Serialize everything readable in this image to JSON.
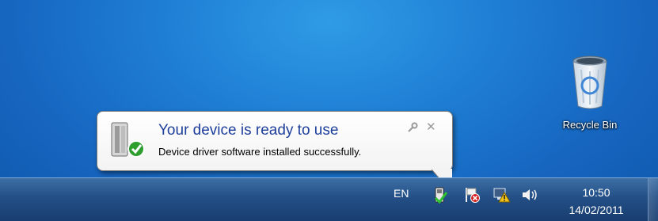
{
  "desktop": {
    "recycle_bin": {
      "label": "Recycle Bin",
      "icon": "recycle-bin-icon"
    }
  },
  "notification": {
    "title": "Your device is ready to use",
    "message": "Device driver software installed successfully.",
    "icon": "device-installed-icon",
    "options_icon": "wrench-icon",
    "close_label": "✕",
    "title_color": "#1e3f9c"
  },
  "taskbar": {
    "language": "EN",
    "tray_icons": [
      "usb-device-icon",
      "action-center-icon",
      "network-icon",
      "volume-icon"
    ],
    "clock": {
      "time": "10:50",
      "date": "14/02/2011"
    }
  },
  "colors": {
    "desktop": "#1f7fd4",
    "taskbar": "#234f86"
  }
}
